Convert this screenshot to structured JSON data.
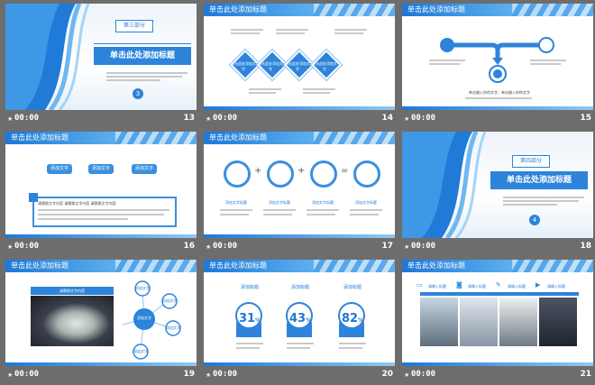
{
  "slides": [
    {
      "num": "13",
      "time": "00:00",
      "section": "第三部分",
      "title": "单击此处添加标题",
      "badge": "3"
    },
    {
      "num": "14",
      "time": "00:00",
      "header": "单击此处添加标题",
      "diamonds": [
        "单击此处添加文字",
        "单击此处添加文字",
        "单击此处添加文字",
        "单击此处添加文字"
      ]
    },
    {
      "num": "15",
      "time": "00:00",
      "header": "单击此处添加标题",
      "caption": "单击输入你的文字，单击输入你的文字"
    },
    {
      "num": "16",
      "time": "00:00",
      "header": "单击此处添加标题",
      "pills": [
        "添加文字",
        "添加文字",
        "添加文字"
      ],
      "box_text": "请替换文字内容 请替换文字内容 请替换文字内容"
    },
    {
      "num": "17",
      "time": "00:00",
      "header": "单击此处添加标题",
      "labels": [
        "添加文字标题",
        "添加文字标题",
        "添加文字标题",
        "添加文字标题"
      ],
      "ops": [
        "+",
        "+",
        "="
      ]
    },
    {
      "num": "18",
      "time": "00:00",
      "section": "第四部分",
      "title": "单击此处添加标题",
      "badge": "4"
    },
    {
      "num": "19",
      "time": "00:00",
      "header": "单击此处添加标题",
      "photo_caption": "请替换文字内容",
      "center": "添加文字",
      "nodes": [
        "添加文字",
        "添加文字",
        "添加文字",
        "添加文字",
        "添加文字"
      ]
    },
    {
      "num": "20",
      "time": "00:00",
      "header": "单击此处添加标题",
      "percents": [
        {
          "label": "添加标题",
          "value": "31",
          "unit": "%"
        },
        {
          "label": "添加标题",
          "value": "43",
          "unit": "%"
        },
        {
          "label": "添加标题",
          "value": "82",
          "unit": "%"
        }
      ]
    },
    {
      "num": "21",
      "time": "00:00",
      "header": "单击此处添加标题",
      "items": [
        "请输入标题",
        "请输入标题",
        "请输入标题",
        "请输入标题"
      ]
    }
  ],
  "colors": {
    "accent": "#1e78d6",
    "background": "#6d6d6d"
  }
}
